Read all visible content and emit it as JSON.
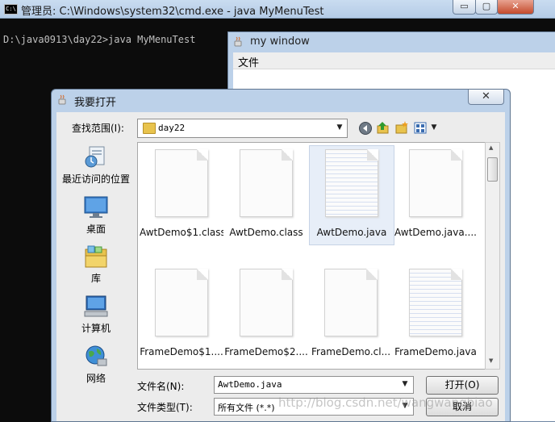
{
  "cmd": {
    "title": "管理员: C:\\Windows\\system32\\cmd.exe - java  MyMenuTest",
    "icon_label": "C:\\",
    "prompt": "D:\\java0913\\day22>java MyMenuTest",
    "buttons": {
      "minimize": "▭",
      "maximize": "▢",
      "close": "✕"
    }
  },
  "mywindow": {
    "title": "my window",
    "menu": [
      "文件"
    ]
  },
  "dialog": {
    "title": "我要打开",
    "close": "✕",
    "look_in_label": "查找范围(I):",
    "look_in_value": "day22",
    "sidebar": [
      {
        "label": "最近访问的位置",
        "icon": "recent-places-icon"
      },
      {
        "label": "桌面",
        "icon": "desktop-icon"
      },
      {
        "label": "库",
        "icon": "libraries-icon"
      },
      {
        "label": "计算机",
        "icon": "computer-icon"
      },
      {
        "label": "网络",
        "icon": "network-icon"
      }
    ],
    "files": [
      {
        "name": "AwtDemo$1.class",
        "type": "class"
      },
      {
        "name": "AwtDemo.class",
        "type": "class"
      },
      {
        "name": "AwtDemo.java",
        "type": "java",
        "selected": true
      },
      {
        "name": "AwtDemo.java....",
        "type": "class"
      },
      {
        "name": "FrameDemo$1....",
        "type": "class"
      },
      {
        "name": "FrameDemo$2....",
        "type": "class"
      },
      {
        "name": "FrameDemo.cl...",
        "type": "class"
      },
      {
        "name": "FrameDemo.java",
        "type": "java"
      }
    ],
    "filename_label": "文件名(N):",
    "filename_value": "AwtDemo.java",
    "filetype_label": "文件类型(T):",
    "filetype_value": "所有文件 (*.*)",
    "open_button": "打开(O)",
    "cancel_button": "取消"
  },
  "watermark": "http://blog.csdn.net/wangwangbiao",
  "colors": {
    "accent": "#bcd1e9",
    "terminal_text": "#c0c0c0",
    "terminal_bg": "#0c0c0c"
  }
}
